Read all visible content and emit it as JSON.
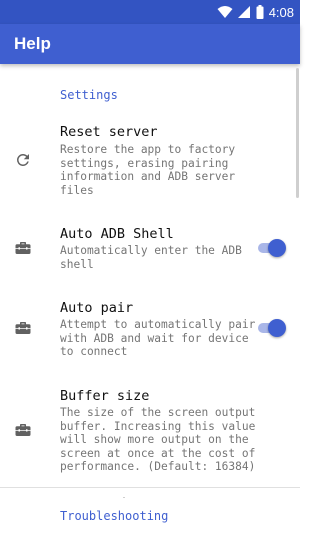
{
  "status_bar": {
    "time": "4:08",
    "icons": [
      "wifi-icon",
      "cell-signal-icon",
      "battery-icon"
    ]
  },
  "app_bar": {
    "title": "Help"
  },
  "colors": {
    "primary": "#3f5fd0",
    "status_bar": "#3354c2",
    "accent": "#3f5fd0"
  },
  "settings_header": "Settings",
  "preferences": [
    {
      "title": "Reset server",
      "summary": "Restore the app to factory settings, erasing pairing information and ADB server files",
      "icon": "refresh-icon"
    },
    {
      "title": "Auto ADB Shell",
      "summary": "Automatically enter the ADB shell",
      "icon": "toolbox-icon",
      "switch_on": true
    },
    {
      "title": "Auto pair",
      "summary": "Attempt to automatically pair with ADB and wait for device to connect",
      "icon": "toolbox-icon",
      "switch_on": true
    },
    {
      "title": "Buffer size",
      "summary": "The size of the screen output buffer. Increasing this value will show more output on the screen at once at the cost of performance. (Default: 16384)",
      "icon": "toolbox-icon"
    }
  ],
  "troubleshooting_header": "Troubleshooting"
}
